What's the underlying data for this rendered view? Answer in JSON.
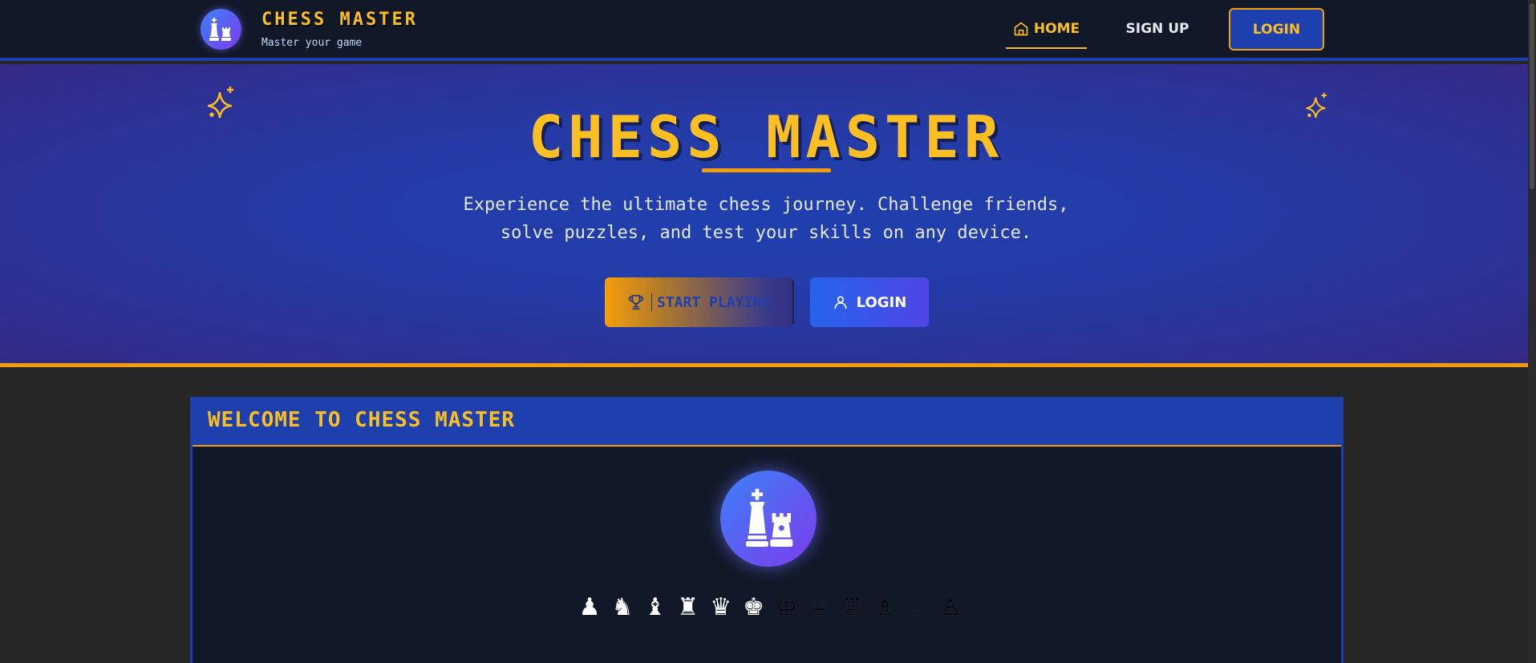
{
  "nav": {
    "brand_title": "CHESS MASTER",
    "brand_subtitle": "Master your game",
    "home_label": "HOME",
    "signup_label": "SIGN UP",
    "login_label": "LOGIN"
  },
  "hero": {
    "title": "CHESS MASTER",
    "description": "Experience the ultimate chess journey. Challenge friends, solve puzzles, and test your skills on any device.",
    "start_label": "START PLAYING",
    "login_label": "LOGIN"
  },
  "welcome": {
    "title": "WELCOME TO CHESS MASTER",
    "pieces": [
      {
        "glyph": "♟",
        "color": "white"
      },
      {
        "glyph": "♞",
        "color": "white"
      },
      {
        "glyph": "♝",
        "color": "white"
      },
      {
        "glyph": "♜",
        "color": "white"
      },
      {
        "glyph": "♛",
        "color": "white"
      },
      {
        "glyph": "♚",
        "color": "white"
      },
      {
        "glyph": "♔",
        "color": "black"
      },
      {
        "glyph": "♕",
        "color": "black"
      },
      {
        "glyph": "♖",
        "color": "black"
      },
      {
        "glyph": "♗",
        "color": "black"
      },
      {
        "glyph": "♘",
        "color": "black"
      },
      {
        "glyph": "♙",
        "color": "black"
      }
    ]
  },
  "colors": {
    "accent": "#fbbf24",
    "primary": "#1e40af",
    "dark": "#111827"
  },
  "icons": {
    "logo": "chess-king-rook-icon",
    "home": "home-icon",
    "trophy": "trophy-icon",
    "user": "user-icon",
    "sparkle": "sparkle-icon"
  }
}
